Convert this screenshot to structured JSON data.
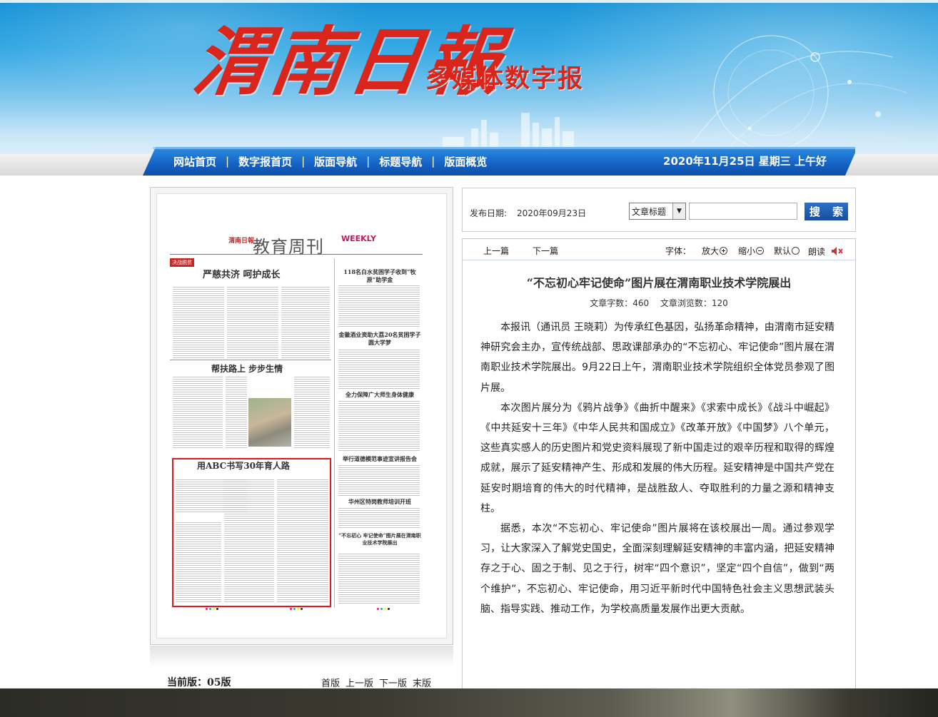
{
  "header": {
    "logo_text": "渭南日報",
    "subtitle": "多媒体数字报"
  },
  "nav": {
    "items": [
      "网站首页",
      "数字报首页",
      "版面导航",
      "标题导航",
      "版面概览"
    ],
    "separator": "|",
    "date_text": "2020年11月25日 星期三 上午好"
  },
  "paper_thumb": {
    "masthead": "渭南日報",
    "section_title": "教育周刊",
    "weekly": "WEEKLY",
    "headlines": [
      "严慈共济 呵护成长",
      "帮扶路上 步步生情",
      "用ABC书写30年育人路",
      "118名白水贫困学子收到“牧原”助学金",
      "金徽酒业资助大荔20名贫困学子圆大学梦",
      "全力保障广大师生身体健康",
      "举行道德模范事迹宣讲报告会",
      "华州区特岗教师培训开班",
      "“不忘初心 牢记使命”图片展在渭南职业技术学院展出"
    ]
  },
  "page_nav": {
    "current": "当前版：05版",
    "links": [
      "首版",
      "上一版",
      "下一版",
      "末版"
    ]
  },
  "search": {
    "pub_label": "发布日期:",
    "pub_date": "2020年09月23日",
    "select_value": "文章标题",
    "input_value": "",
    "button_label": "搜 索"
  },
  "toolbar": {
    "prev": "上一篇",
    "next": "下一篇",
    "font_label": "字体：",
    "zoom_in": "放大",
    "zoom_out": "缩小",
    "default": "默认",
    "read": "朗读"
  },
  "article": {
    "title": "“不忘初心牢记使命”图片展在渭南职业技术学院展出",
    "stats": "文章字数：460　 文章浏览数：120",
    "paragraphs": [
      "本报讯（通讯员 王晓莉）为传承红色基因，弘扬革命精神，由渭南市延安精神研究会主办，宣传统战部、思政课部承办的“不忘初心、牢记使命”图片展在渭南职业技术学院展出。9月22日上午，渭南职业技术学院组织全体党员参观了图片展。",
      "本次图片展分为《鸦片战争》《曲折中醒来》《求索中成长》《战斗中崛起》《中共延安十三年》《中华人民共和国成立》《改革开放》《中国梦》八个单元，这些真实感人的历史图片和党史资料展现了新中国走过的艰辛历程和取得的辉煌成就，展示了延安精神产生、形成和发展的伟大历程。延安精神是中国共产党在延安时期培育的伟大的时代精神，是战胜敌人、夺取胜利的力量之源和精神支柱。",
      "据悉，本次“不忘初心、牢记使命”图片展将在该校展出一周。通过参观学习，让大家深入了解党史国史，全面深刻理解延安精神的丰富内涵，把延安精神存之于心、固之于制、见之于行，树牢“四个意识”，坚定“四个自信”，做到“两个维护”，不忘初心、牢记使命，用习近平新时代中国特色社会主义思想武装头脑、指导实践、推动工作，为学校高质量发展作出更大贡献。"
    ]
  },
  "colors": {
    "nav_blue": "#1565c8",
    "logo_red": "#d9251b",
    "search_button": "#1f5bb0",
    "highlight_box": "#e0191c"
  }
}
